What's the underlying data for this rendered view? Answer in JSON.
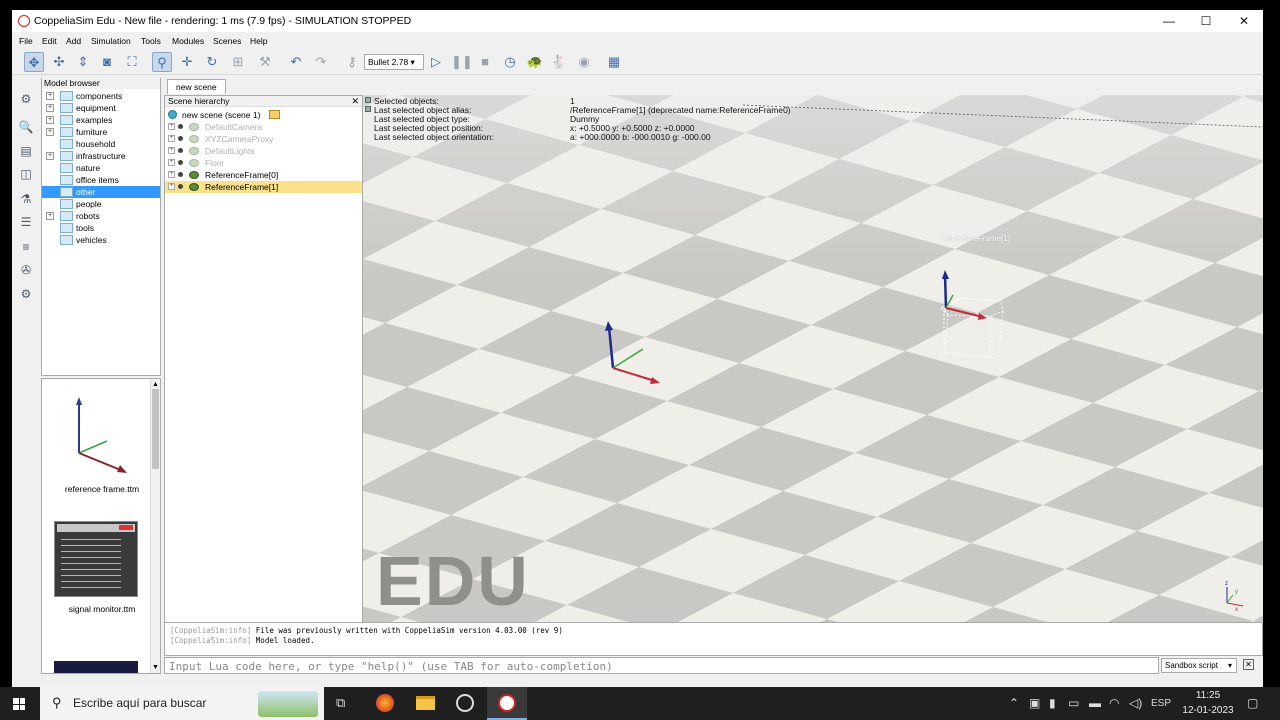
{
  "window": {
    "title": "CoppeliaSim Edu - New file - rendering: 1 ms (7.9 fps) - SIMULATION STOPPED",
    "minimize": "—",
    "maximize": "☐",
    "close": "✕"
  },
  "menu": [
    "File",
    "Edit",
    "Add",
    "Simulation",
    "Tools",
    "Modules",
    "Scenes",
    "Help"
  ],
  "toolbar": {
    "engine": "Bullet 2.78"
  },
  "model_browser": {
    "header": "Model browser",
    "items": [
      {
        "label": "components",
        "expandable": true
      },
      {
        "label": "equipment",
        "expandable": true
      },
      {
        "label": "examples",
        "expandable": true
      },
      {
        "label": "furniture",
        "expandable": true
      },
      {
        "label": "household",
        "expandable": false
      },
      {
        "label": "infrastructure",
        "expandable": true
      },
      {
        "label": "nature",
        "expandable": false
      },
      {
        "label": "office items",
        "expandable": false
      },
      {
        "label": "other",
        "expandable": false,
        "selected": true
      },
      {
        "label": "people",
        "expandable": false
      },
      {
        "label": "robots",
        "expandable": true
      },
      {
        "label": "tools",
        "expandable": false
      },
      {
        "label": "vehicles",
        "expandable": false
      }
    ],
    "thumbnails": [
      "reference frame.ttm",
      "signal monitor.ttm"
    ]
  },
  "scene_tab": "new scene",
  "hierarchy": {
    "header": "Scene hierarchy",
    "root": "new scene (scene 1)",
    "items": [
      {
        "label": "DefaultCamera",
        "dim": true
      },
      {
        "label": "XYZCameraProxy",
        "dim": true
      },
      {
        "label": "DefaultLights",
        "dim": true
      },
      {
        "label": "Floor",
        "dim": true
      },
      {
        "label": "ReferenceFrame[0]",
        "dim": false
      },
      {
        "label": "ReferenceFrame[1]",
        "dim": false,
        "selected": true
      }
    ]
  },
  "viewport": {
    "info_keys": [
      "Selected objects:",
      "Last selected object alias:",
      "Last selected object type:",
      "Last selected object position:",
      "Last selected object orientation:"
    ],
    "info_values": [
      "1",
      "/ReferenceFrame[1]    (deprecated name:ReferenceFrame0)",
      "Dummy",
      "x: +0.5000    y: +0.5000    z: +0.0000",
      "a: +000.0000    b: -000.0010    g: -000.00"
    ],
    "watermark": "EDU",
    "object_label": "ReferenceFrame[1]"
  },
  "console": {
    "lines": [
      {
        "tag": "[CoppeliaSim:info]",
        "text": "File was previously written with CoppeliaSim version 4.03.00 (rev 9)"
      },
      {
        "tag": "[CoppeliaSim:info]",
        "text": "Model loaded."
      }
    ],
    "input_placeholder": "Input Lua code here, or type \"help()\" (use TAB for auto-completion)",
    "script_select": "Sandbox script"
  },
  "taskbar": {
    "search_placeholder": "Escribe aquí para buscar",
    "language": "ESP",
    "time": "11:25",
    "date": "12-01-2023"
  },
  "colors": {
    "selection_blue": "#3399ff",
    "hierarchy_selection": "#fce08a",
    "floor_light": "#efeee9",
    "floor_dark": "#c9c8c4"
  }
}
